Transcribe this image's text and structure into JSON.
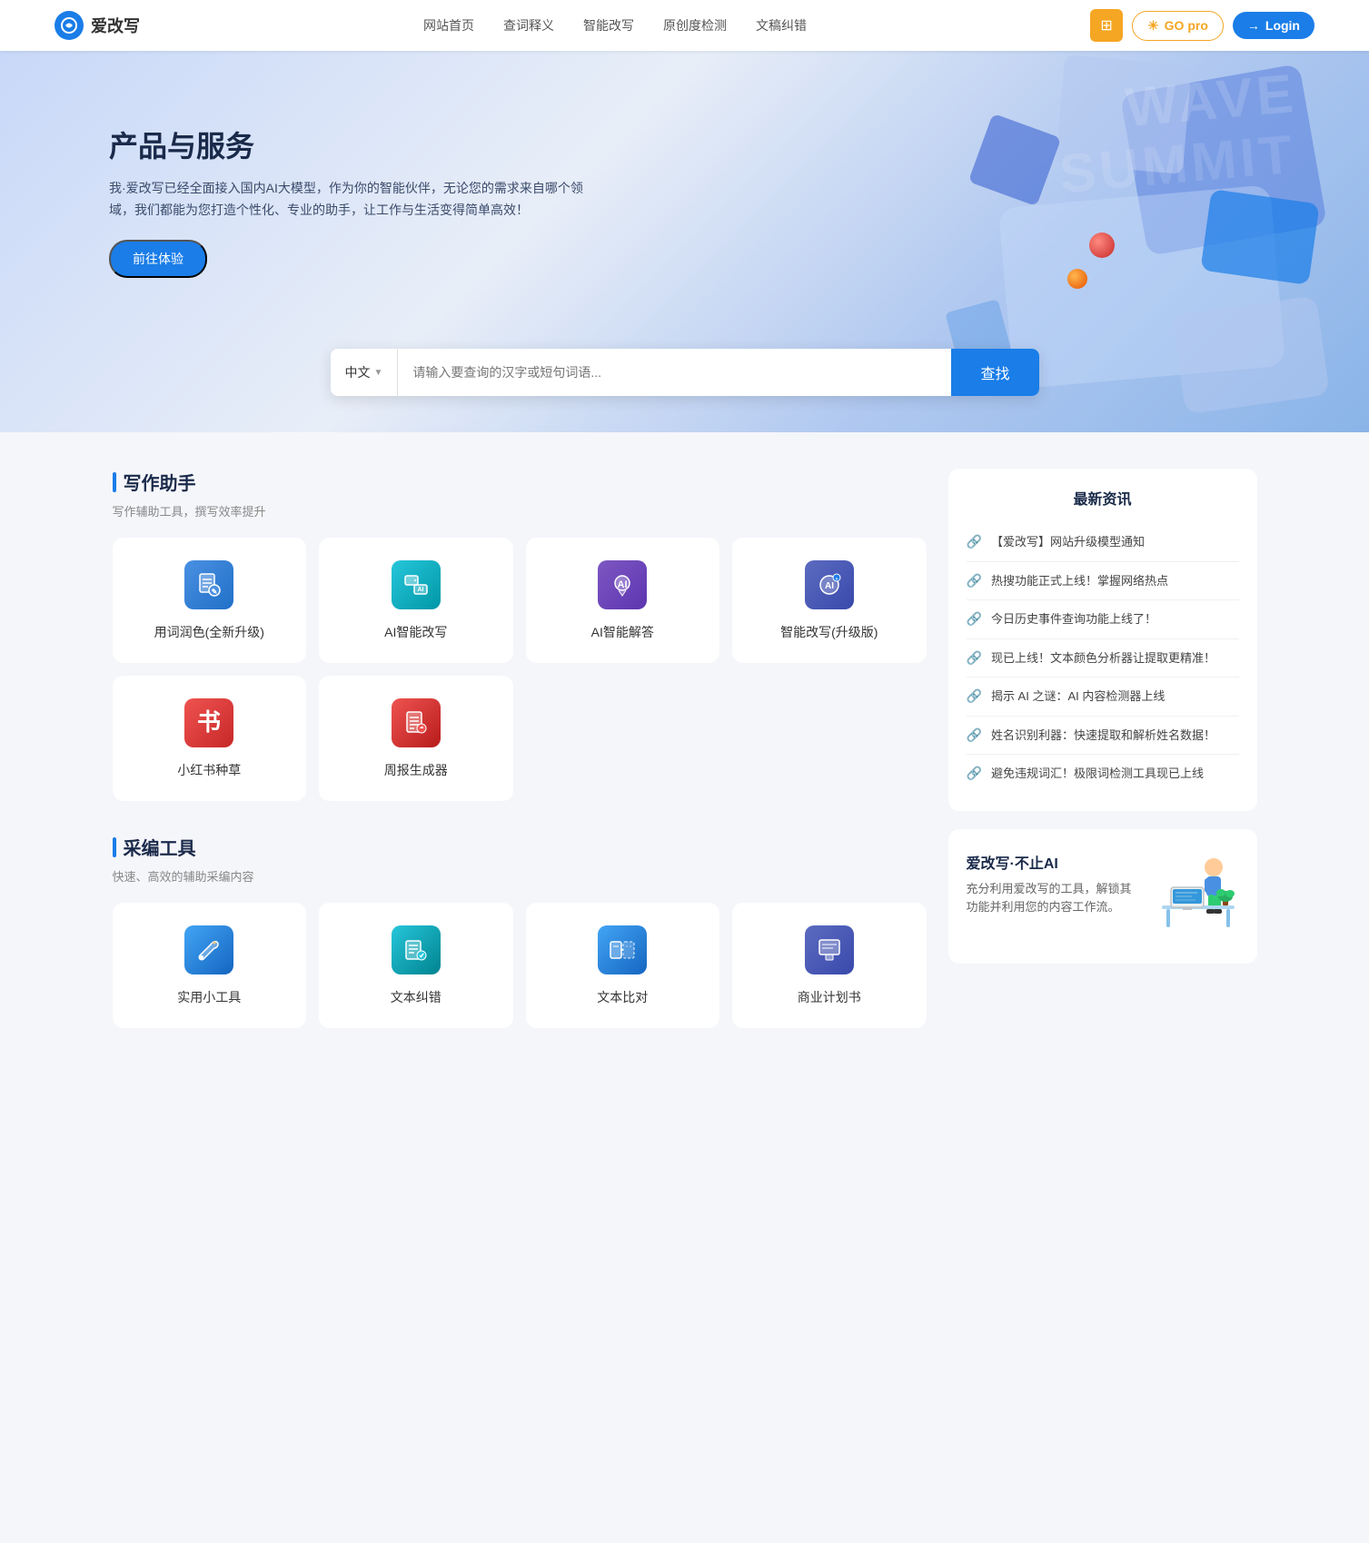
{
  "navbar": {
    "logo_icon_alt": "aigaixie-logo",
    "logo_text": "爱改写",
    "nav_items": [
      {
        "label": "网站首页",
        "href": "#"
      },
      {
        "label": "查词释义",
        "href": "#"
      },
      {
        "label": "智能改写",
        "href": "#"
      },
      {
        "label": "原创度检测",
        "href": "#"
      },
      {
        "label": "文稿纠错",
        "href": "#"
      }
    ],
    "btn_grid_icon": "grid-icon",
    "btn_go_pro": "GO pro",
    "btn_login": "Login"
  },
  "hero": {
    "title": "产品与服务",
    "description": "我·爱改写已经全面接入国内AI大模型，作为你的智能伙伴，无论您的需求来自哪个领域，我们都能为您打造个性化、专业的助手，让工作与生活变得简单高效！",
    "cta_btn": "前往体验",
    "search": {
      "lang": "中文",
      "placeholder": "请输入要查询的汉字或短句词语...",
      "btn_label": "查找"
    }
  },
  "writing_tools": {
    "section_title": "写作助手",
    "section_sub": "写作辅助工具，撰写效率提升",
    "tools": [
      {
        "id": "word-polish",
        "label": "用词润色(全新升级)",
        "icon": "document-edit-icon",
        "icon_type": "blue-doc"
      },
      {
        "id": "ai-rewrite",
        "label": "AI智能改写",
        "icon": "ai-rewrite-icon",
        "icon_type": "teal"
      },
      {
        "id": "ai-answer",
        "label": "AI智能解答",
        "icon": "ai-answer-icon",
        "icon_type": "purple"
      },
      {
        "id": "smart-rewrite-pro",
        "label": "智能改写(升级版)",
        "icon": "smart-rewrite-pro-icon",
        "icon_type": "indigo"
      },
      {
        "id": "xiaohongshu",
        "label": "小红书种草",
        "icon": "book-icon",
        "icon_type": "red"
      },
      {
        "id": "weekly-report",
        "label": "周报生成器",
        "icon": "report-icon",
        "icon_type": "red-doc"
      }
    ]
  },
  "editing_tools": {
    "section_title": "采编工具",
    "section_sub": "快速、高效的辅助采编内容",
    "tools": [
      {
        "id": "utility",
        "label": "实用小工具",
        "icon": "wrench-icon",
        "icon_type": "wrench"
      },
      {
        "id": "text-correct",
        "label": "文本纠错",
        "icon": "text-correct-icon",
        "icon_type": "cyan"
      },
      {
        "id": "text-compare",
        "label": "文本比对",
        "icon": "text-compare-icon",
        "icon_type": "blue2"
      },
      {
        "id": "business-plan",
        "label": "商业计划书",
        "icon": "business-plan-icon",
        "icon_type": "indigo"
      }
    ]
  },
  "news": {
    "title": "最新资讯",
    "items": [
      {
        "text": "【爱改写】网站升级模型通知"
      },
      {
        "text": "热搜功能正式上线！掌握网络热点"
      },
      {
        "text": "今日历史事件查询功能上线了！"
      },
      {
        "text": "现已上线！文本颜色分析器让提取更精准！"
      },
      {
        "text": "揭示 AI 之谜：AI 内容检测器上线"
      },
      {
        "text": "姓名识别利器：快速提取和解析姓名数据！"
      },
      {
        "text": "避免违规词汇！极限词检测工具现已上线"
      }
    ]
  },
  "promo": {
    "title": "爱改写·不止AI",
    "description": "充分利用爱改写的工具，解锁其功能并利用您的内容工作流。"
  }
}
